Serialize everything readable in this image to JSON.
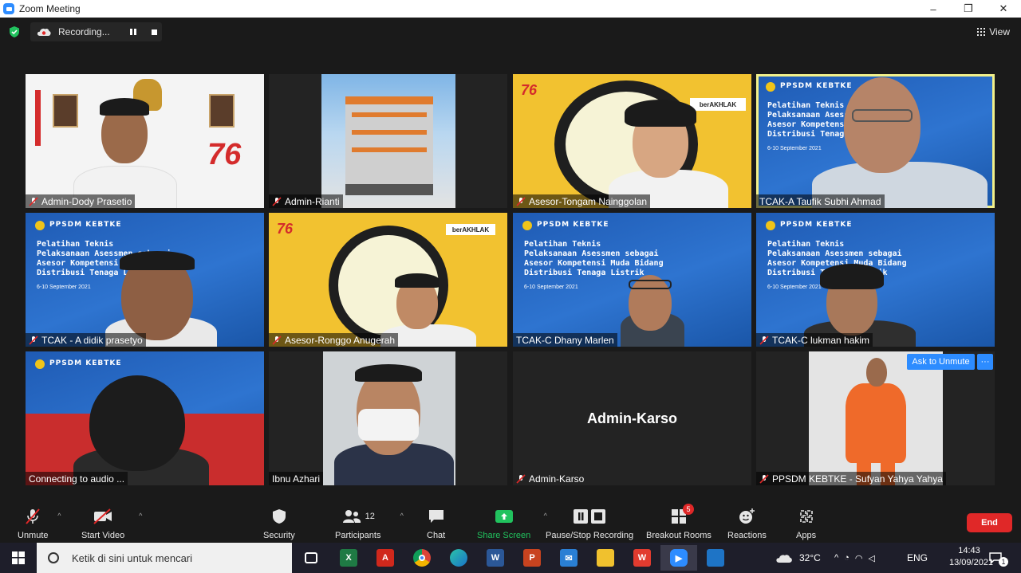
{
  "window": {
    "title": "Zoom Meeting",
    "controls": [
      "–",
      "❐",
      "✕"
    ]
  },
  "recording": {
    "label": "Recording..."
  },
  "view": {
    "label": "View"
  },
  "tiles": [
    {
      "name": "Admin-Dody Prasetio",
      "muted": true
    },
    {
      "name": "Admin-Rianti",
      "muted": true
    },
    {
      "name": "Asesor-Tongam Nainggolan",
      "muted": true
    },
    {
      "name": "TCAK-A Taufik Subhi Ahmad",
      "muted": false,
      "active": true
    },
    {
      "name": "TCAK - A didik prasetyo",
      "muted": true
    },
    {
      "name": "Asesor-Ronggo Anugerah",
      "muted": true
    },
    {
      "name": "TCAK-C Dhany Marlen",
      "muted": false
    },
    {
      "name": "TCAK-C lukman hakim",
      "muted": true
    },
    {
      "name": "Connecting to audio ...",
      "muted": false
    },
    {
      "name": "Ibnu Azhari",
      "muted": false
    },
    {
      "name": "Admin-Karso",
      "muted": true,
      "center_name": "Admin-Karso"
    },
    {
      "name": "PPSDM KEBTKE - Sufyan Yahya Yahya",
      "muted": true
    }
  ],
  "banner": {
    "org": "PPSDM KEBTKE",
    "lines": [
      "Pelatihan Teknis",
      "Pelaksanaan Asessmen sebagai",
      "Asesor Kompetensi Muda Bidang",
      "Distribusi Tenaga Listrik"
    ],
    "date": "6-10 September 2021"
  },
  "poster": {
    "anniversary": "76",
    "brand": "berAKHLAK"
  },
  "ask_unmute": {
    "label": "Ask to Unmute",
    "more": "···"
  },
  "toolbar": {
    "unmute": "Unmute",
    "start_video": "Start Video",
    "security": "Security",
    "participants": "Participants",
    "participants_count": "12",
    "chat": "Chat",
    "share_screen": "Share Screen",
    "recording": "Pause/Stop Recording",
    "breakout": "Breakout Rooms",
    "breakout_badge": "5",
    "reactions": "Reactions",
    "apps": "Apps",
    "end": "End"
  },
  "taskbar": {
    "search_placeholder": "Ketik di sini untuk mencari",
    "temperature": "32°C",
    "language": "ENG",
    "time": "14:43",
    "date": "13/09/2021",
    "notifications": "1"
  },
  "colors": {
    "zoom_blue": "#2d8cff",
    "end_red": "#e02828",
    "share_green": "#21c25e",
    "active_border": "#f2f08a"
  }
}
